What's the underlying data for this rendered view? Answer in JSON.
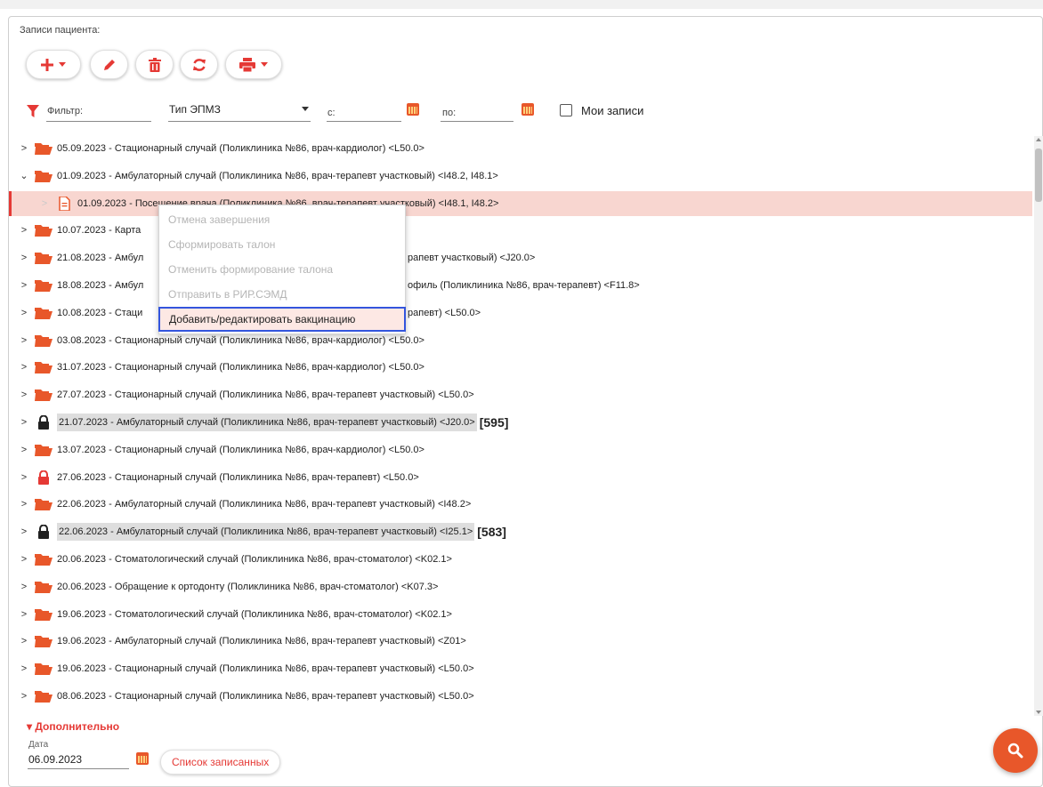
{
  "panel": {
    "title": "Записи пациента:"
  },
  "toolbar": {
    "add_icon": "plus-icon",
    "edit_icon": "pencil-icon",
    "delete_icon": "trash-icon",
    "refresh_icon": "refresh-icon",
    "print_icon": "printer-icon"
  },
  "filter": {
    "label": "Фильтр:",
    "type_select": "Тип ЭПМЗ",
    "from_label": "с:",
    "to_label": "по:",
    "my_records_label": "Мои записи",
    "my_records_checked": false
  },
  "records": [
    {
      "text": "05.09.2023 - Стационарный случай (Поликлиника №86, врач-кардиолог) <L50.0>",
      "icon": "folder",
      "expanded": false,
      "highlighted": false,
      "badge": ""
    },
    {
      "text": "01.09.2023 - Амбулаторный случай (Поликлиника №86, врач-терапевт участковый) <I48.2, I48.1>",
      "icon": "folder",
      "expanded": true,
      "highlighted": false,
      "badge": ""
    },
    {
      "text": "01.09.2023 - Посещение врача (Поликлиника №86, врач-терапевт участковый) <I48.1, I48.2>",
      "icon": "document",
      "expanded": false,
      "highlighted": false,
      "badge": "",
      "child": true,
      "selected": true
    },
    {
      "text": "10.07.2023 - Карта",
      "icon": "folder",
      "expanded": false,
      "highlighted": false,
      "badge": ""
    },
    {
      "text": "21.08.2023 - Амбул",
      "tail": "рапевт участковый) <J20.0>",
      "icon": "folder",
      "expanded": false,
      "highlighted": false,
      "badge": ""
    },
    {
      "text": "18.08.2023 - Амбул",
      "tail": "офиль (Поликлиника №86, врач-терапевт) <F11.8>",
      "icon": "folder",
      "expanded": false,
      "highlighted": false,
      "badge": ""
    },
    {
      "text": "10.08.2023 - Стаци",
      "tail": "рапевт) <L50.0>",
      "icon": "folder",
      "expanded": false,
      "highlighted": false,
      "badge": ""
    },
    {
      "text": "03.08.2023 - Стационарный случай (Поликлиника №86, врач-кардиолог) <L50.0>",
      "icon": "folder",
      "expanded": false,
      "highlighted": false,
      "badge": ""
    },
    {
      "text": "31.07.2023 - Стационарный случай (Поликлиника №86, врач-кардиолог) <L50.0>",
      "icon": "folder",
      "expanded": false,
      "highlighted": false,
      "badge": ""
    },
    {
      "text": "27.07.2023 - Стационарный случай (Поликлиника №86, врач-терапевт участковый) <L50.0>",
      "icon": "folder",
      "expanded": false,
      "highlighted": false,
      "badge": ""
    },
    {
      "text": "21.07.2023 - Амбулаторный случай (Поликлиника №86, врач-терапевт участковый) <J20.0>",
      "icon": "lock-black",
      "expanded": false,
      "highlighted": true,
      "badge": "[595]"
    },
    {
      "text": "13.07.2023 - Стационарный случай (Поликлиника №86, врач-кардиолог) <L50.0>",
      "icon": "folder",
      "expanded": false,
      "highlighted": false,
      "badge": ""
    },
    {
      "text": "27.06.2023 - Стационарный случай (Поликлиника №86, врач-терапевт) <L50.0>",
      "icon": "lock-red",
      "expanded": false,
      "highlighted": false,
      "badge": ""
    },
    {
      "text": "22.06.2023 - Амбулаторный случай (Поликлиника №86, врач-терапевт участковый) <I48.2>",
      "icon": "folder",
      "expanded": false,
      "highlighted": false,
      "badge": ""
    },
    {
      "text": "22.06.2023 - Амбулаторный случай (Поликлиника №86, врач-терапевт участковый) <I25.1>",
      "icon": "lock-black",
      "expanded": false,
      "highlighted": true,
      "badge": "[583]"
    },
    {
      "text": "20.06.2023 - Стоматологический случай (Поликлиника №86, врач-стоматолог) <K02.1>",
      "icon": "folder",
      "expanded": false,
      "highlighted": false,
      "badge": ""
    },
    {
      "text": "20.06.2023 - Обращение к ортодонту (Поликлиника №86, врач-стоматолог) <K07.3>",
      "icon": "folder",
      "expanded": false,
      "highlighted": false,
      "badge": ""
    },
    {
      "text": "19.06.2023 - Стоматологический случай (Поликлиника №86, врач-стоматолог) <K02.1>",
      "icon": "folder",
      "expanded": false,
      "highlighted": false,
      "badge": ""
    },
    {
      "text": "19.06.2023 - Амбулаторный случай (Поликлиника №86, врач-терапевт участковый) <Z01>",
      "icon": "folder",
      "expanded": false,
      "highlighted": false,
      "badge": ""
    },
    {
      "text": "19.06.2023 - Стационарный случай (Поликлиника №86, врач-терапевт участковый) <L50.0>",
      "icon": "folder",
      "expanded": false,
      "highlighted": false,
      "badge": ""
    },
    {
      "text": "08.06.2023 - Стационарный случай (Поликлиника №86, врач-терапевт участковый) <L50.0>",
      "icon": "folder",
      "expanded": false,
      "highlighted": false,
      "badge": ""
    }
  ],
  "context_menu": {
    "items": [
      {
        "label": "Отмена завершения",
        "enabled": false
      },
      {
        "label": "Сформировать талон",
        "enabled": false
      },
      {
        "label": "Отменить формирование талона",
        "enabled": false
      },
      {
        "label": "Отправить в РИР.СЭМД",
        "enabled": false
      },
      {
        "label": "Добавить/редактировать вакцинацию",
        "enabled": true
      }
    ]
  },
  "extra": {
    "toggle_label": "▾ Дополнительно",
    "date_label": "Дата",
    "date_value": "06.09.2023",
    "list_button": "Список записанных"
  },
  "colors": {
    "accent": "#e53935",
    "folder": "#e8572a",
    "selected_row": "#f8d6d0",
    "focus_border": "#3355dd"
  }
}
